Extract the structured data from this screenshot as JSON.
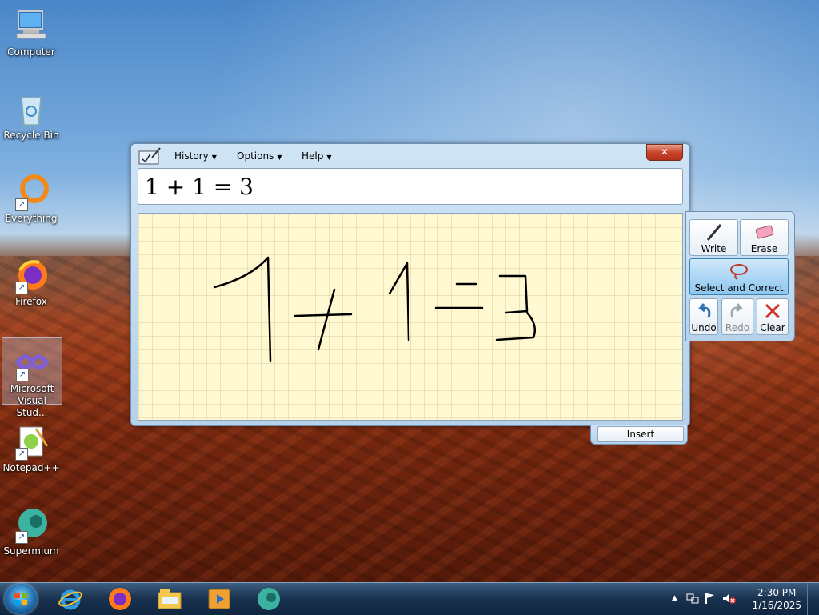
{
  "desktop": {
    "icons": [
      {
        "label": "Computer"
      },
      {
        "label": "Recycle Bin"
      },
      {
        "label": "Everything"
      },
      {
        "label": "Firefox"
      },
      {
        "label": "Microsoft Visual Stud..."
      },
      {
        "label": "Notepad++"
      },
      {
        "label": "Supermium"
      }
    ]
  },
  "math_input_panel": {
    "menu": [
      {
        "label": "History"
      },
      {
        "label": "Options"
      },
      {
        "label": "Help"
      }
    ],
    "close_label": "✕",
    "preview_text": "1 + 1 = 3",
    "tools": {
      "write": "Write",
      "erase": "Erase",
      "select_correct": "Select and Correct",
      "undo": "Undo",
      "redo": "Redo",
      "clear": "Clear"
    },
    "insert_label": "Insert"
  },
  "taskbar": {
    "pinned": [
      "internet-explorer-icon",
      "firefox-icon",
      "file-explorer-icon",
      "media-player-icon",
      "supermium-icon"
    ],
    "tray_expand": "▲",
    "clock_time": "2:30 PM",
    "clock_date": "1/16/2025"
  }
}
